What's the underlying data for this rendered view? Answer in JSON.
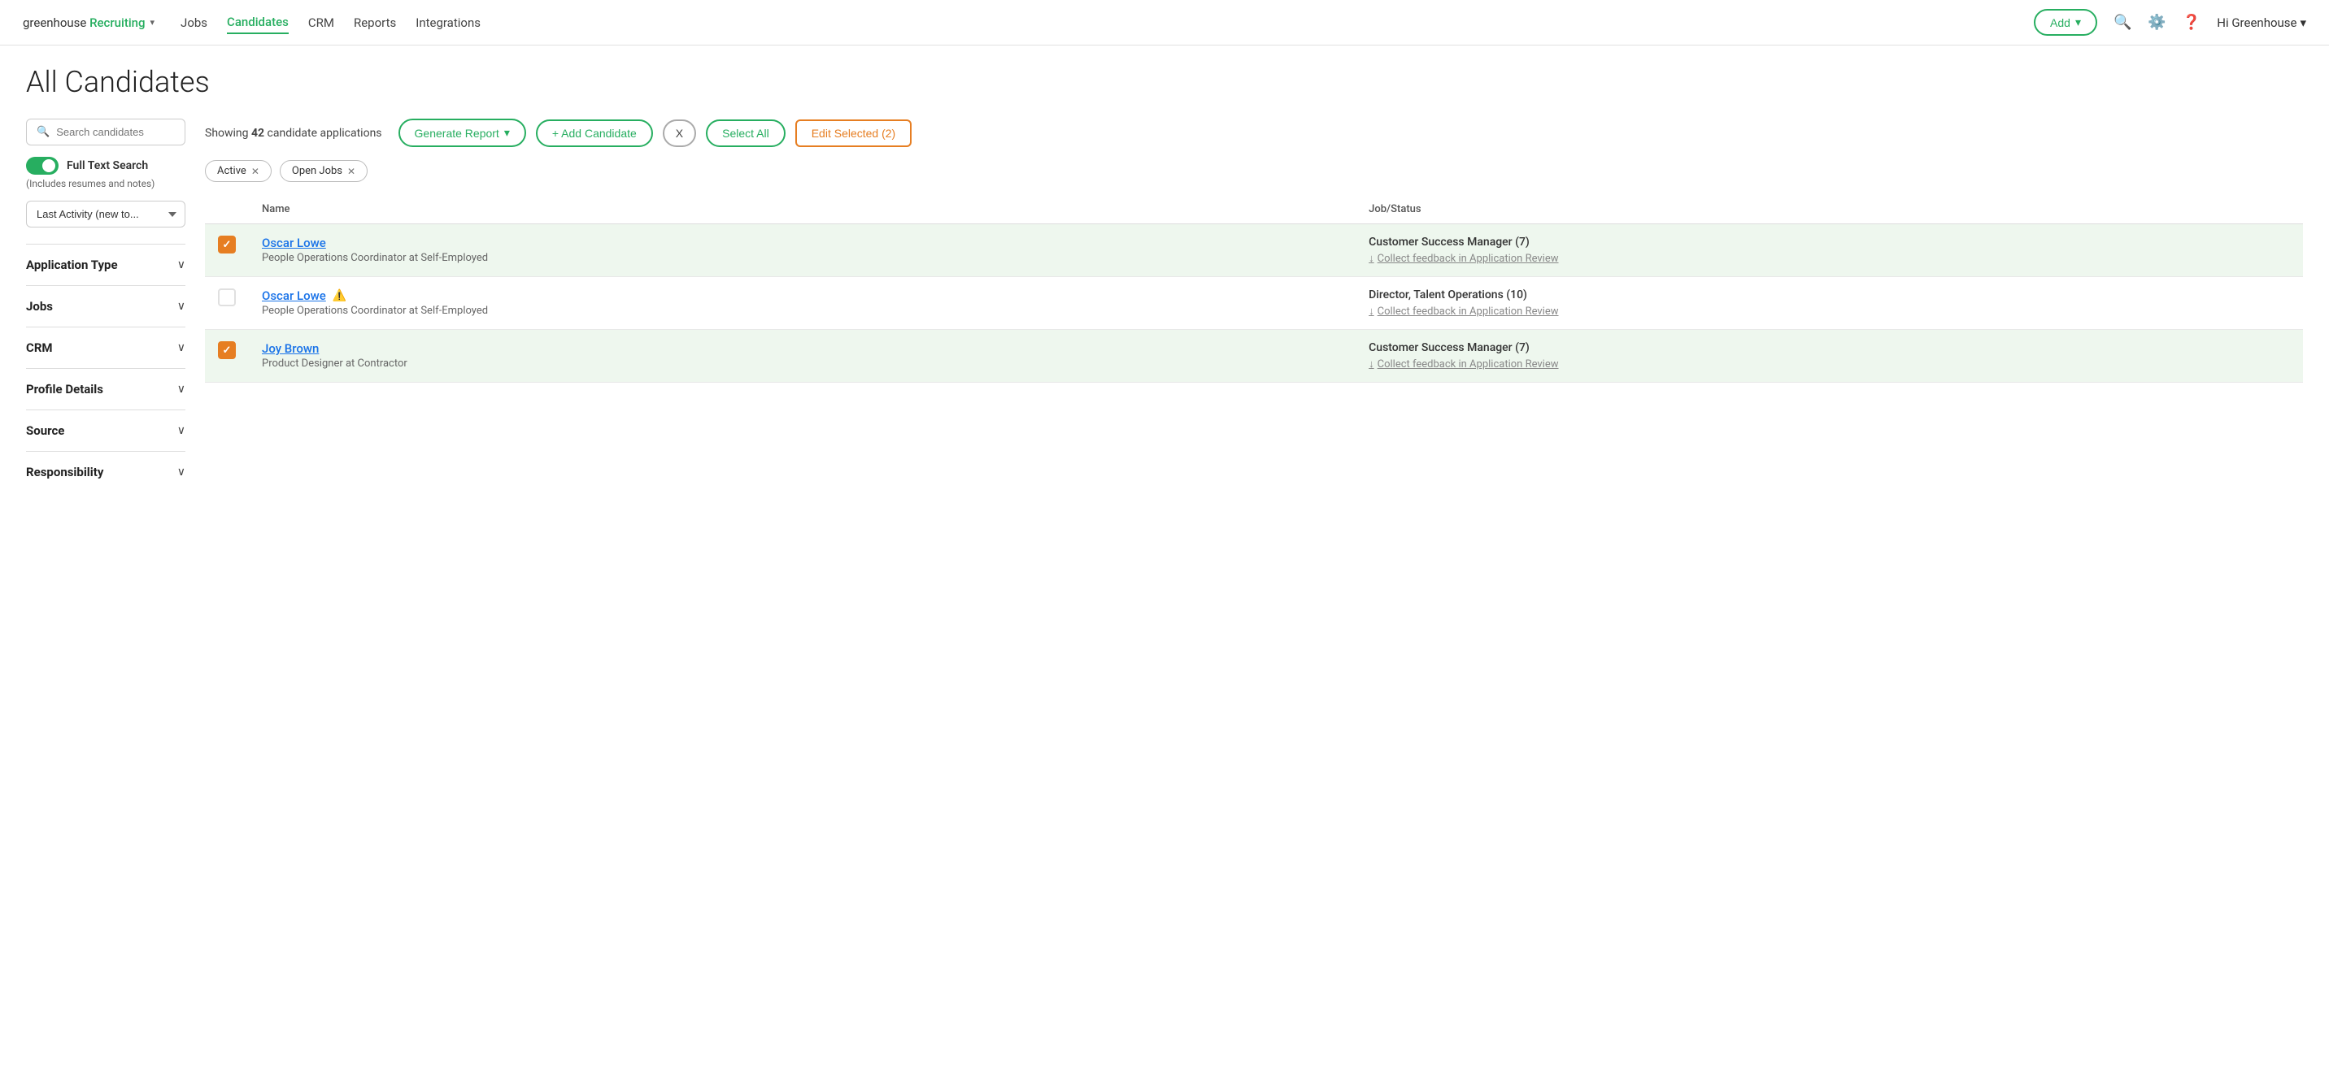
{
  "brand": {
    "logo_text": "greenhouse",
    "logo_colored": "Recruiting",
    "chevron": "▾"
  },
  "nav": {
    "links": [
      {
        "label": "Jobs",
        "active": false
      },
      {
        "label": "Candidates",
        "active": true
      },
      {
        "label": "CRM",
        "active": false
      },
      {
        "label": "Reports",
        "active": false
      },
      {
        "label": "Integrations",
        "active": false
      }
    ],
    "add_button": "Add",
    "user_greeting": "Hi Greenhouse"
  },
  "page": {
    "title": "All Candidates"
  },
  "sidebar": {
    "search_placeholder": "Search candidates",
    "full_text_label": "Full Text Search",
    "full_text_note": "(Includes resumes and notes)",
    "sort_label": "Last Activity (new to...",
    "filters": [
      {
        "title": "Application Type"
      },
      {
        "title": "Jobs"
      },
      {
        "title": "CRM"
      },
      {
        "title": "Profile Details"
      },
      {
        "title": "Source"
      },
      {
        "title": "Responsibility"
      }
    ]
  },
  "toolbar": {
    "showing_prefix": "Showing ",
    "showing_count": "42",
    "showing_suffix": " candidate applications",
    "generate_report_label": "Generate Report",
    "add_candidate_label": "+ Add Candidate",
    "x_label": "X",
    "select_all_label": "Select All",
    "edit_selected_label": "Edit Selected (2)"
  },
  "active_filters": [
    {
      "label": "Active"
    },
    {
      "label": "Open Jobs"
    }
  ],
  "table": {
    "columns": [
      "",
      "Name",
      "Job/Status"
    ],
    "rows": [
      {
        "checked": true,
        "name": "Oscar Lowe",
        "has_alert": false,
        "sub": "People Operations Coordinator at Self-Employed",
        "job_title": "Customer Success Manager (7)",
        "feedback": "Collect feedback in Application Review",
        "selected": true
      },
      {
        "checked": false,
        "name": "Oscar Lowe",
        "has_alert": true,
        "sub": "People Operations Coordinator at Self-Employed",
        "job_title": "Director, Talent Operations (10)",
        "feedback": "Collect feedback in Application Review",
        "selected": false
      },
      {
        "checked": true,
        "name": "Joy Brown",
        "has_alert": false,
        "sub": "Product Designer at Contractor",
        "job_title": "Customer Success Manager (7)",
        "feedback": "Collect feedback in Application Review",
        "selected": true
      }
    ]
  },
  "colors": {
    "green": "#27ae60",
    "orange": "#e67e22",
    "link_blue": "#1a73e8"
  }
}
